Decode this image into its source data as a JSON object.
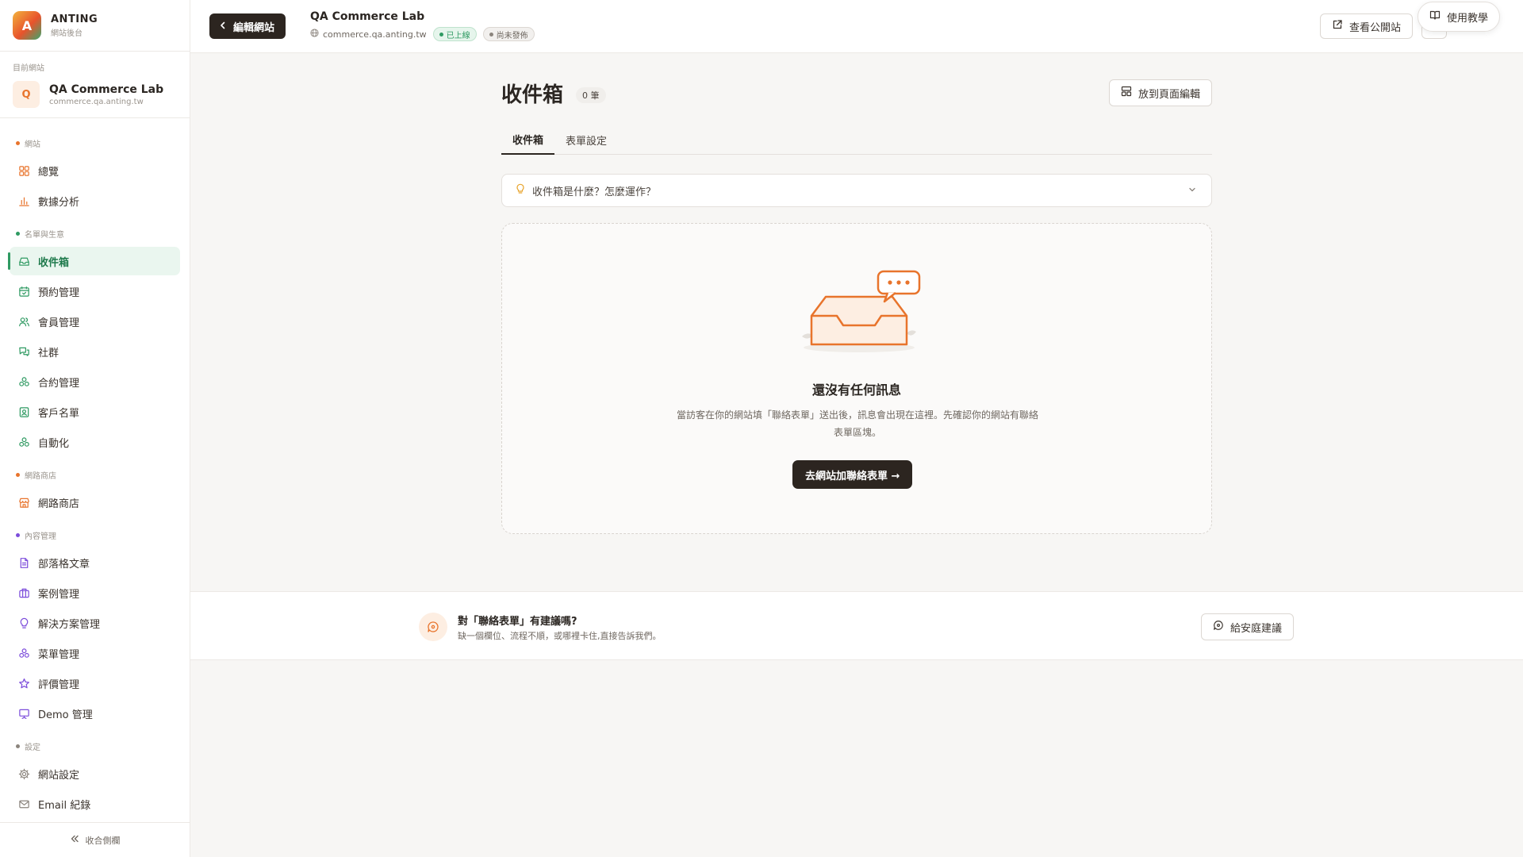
{
  "brand": {
    "logo_letter": "A",
    "name": "ANTING",
    "subtitle": "網站後台"
  },
  "current_site": {
    "caption": "目前網站",
    "avatar_letter": "Q",
    "name": "QA Commerce Lab",
    "domain": "commerce.qa.anting.tw"
  },
  "nav": {
    "sections": [
      {
        "label": "網站",
        "color": "#e8742c",
        "items": [
          {
            "label": "總覽",
            "icon": "grid-icon"
          },
          {
            "label": "數據分析",
            "icon": "bar-chart-icon"
          }
        ]
      },
      {
        "label": "名單與生意",
        "color": "#2f9a62",
        "items": [
          {
            "label": "收件箱",
            "icon": "inbox-icon",
            "active": true
          },
          {
            "label": "預約管理",
            "icon": "calendar-icon"
          },
          {
            "label": "會員管理",
            "icon": "users-icon"
          },
          {
            "label": "社群",
            "icon": "chat-icon"
          },
          {
            "label": "合約管理",
            "icon": "cluster-icon"
          },
          {
            "label": "客戶名單",
            "icon": "contact-icon"
          },
          {
            "label": "自動化",
            "icon": "cluster-icon"
          }
        ]
      },
      {
        "label": "網路商店",
        "color": "#e8742c",
        "items": [
          {
            "label": "網路商店",
            "icon": "store-icon"
          }
        ]
      },
      {
        "label": "內容管理",
        "color": "#7c4ddb",
        "items": [
          {
            "label": "部落格文章",
            "icon": "document-icon"
          },
          {
            "label": "案例管理",
            "icon": "briefcase-icon"
          },
          {
            "label": "解決方案管理",
            "icon": "lightbulb-icon"
          },
          {
            "label": "菜單管理",
            "icon": "cluster-icon"
          },
          {
            "label": "評價管理",
            "icon": "star-icon"
          },
          {
            "label": "Demo 管理",
            "icon": "presentation-icon"
          }
        ]
      },
      {
        "label": "設定",
        "color": "#8b847d",
        "items": [
          {
            "label": "網站設定",
            "icon": "gear-icon"
          },
          {
            "label": "Email 紀錄",
            "icon": "mail-icon"
          }
        ]
      }
    ],
    "collapse_label": "收合側欄"
  },
  "topbar": {
    "edit_button": "編輯網站",
    "site_title": "QA Commerce Lab",
    "site_domain": "commerce.qa.anting.tw",
    "badge_live": "已上線",
    "badge_draft": "尚未發佈",
    "view_button": "查看公開站",
    "help_button": "使用教學"
  },
  "page": {
    "title": "收件箱",
    "count": "0 筆",
    "layout_button": "放到頁面編輯",
    "tabs": [
      {
        "label": "收件箱",
        "active": true
      },
      {
        "label": "表單設定",
        "active": false
      }
    ],
    "accordion_text": "收件箱是什麼？怎麼運作？",
    "empty": {
      "title": "還沒有任何訊息",
      "desc": "當訪客在你的網站填「聯絡表單」送出後，訊息會出現在這裡。先確認你的網站有聯絡表單區塊。",
      "cta": "去網站加聯絡表單 →"
    }
  },
  "feedback": {
    "title": "對「聯絡表單」有建議嗎?",
    "subtitle": "缺一個欄位、流程不順，或哪裡卡住,直接告訴我們。",
    "button": "給安庭建議"
  },
  "colors": {
    "accent_dark": "#2c2520",
    "active_green": "#2f9a62",
    "illustration_orange": "#e8742c"
  }
}
